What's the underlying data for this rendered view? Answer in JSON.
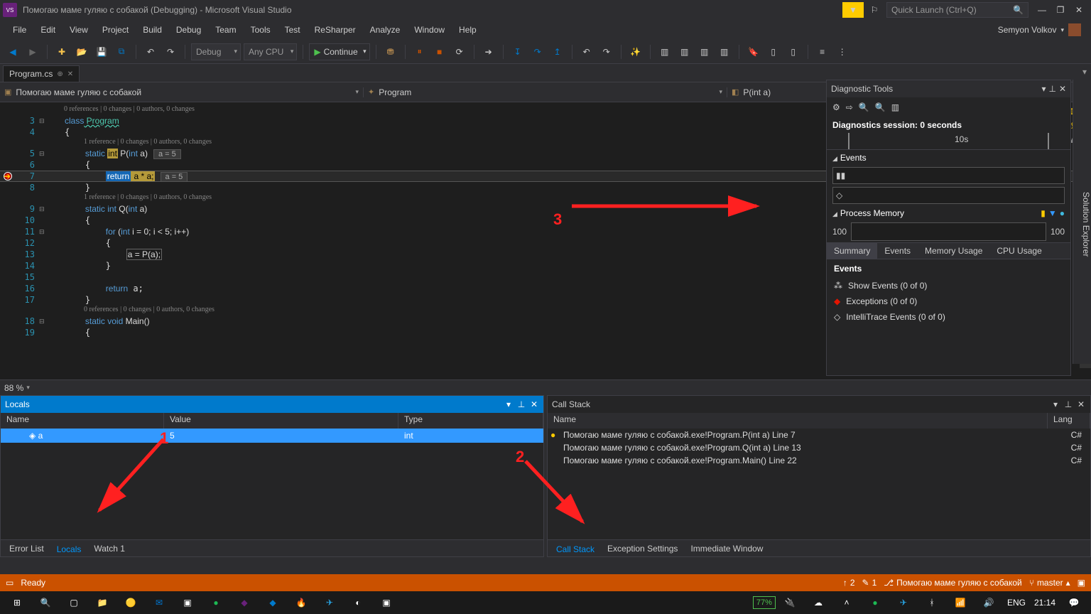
{
  "title": "Помогаю маме гуляю с собакой (Debugging) - Microsoft Visual Studio",
  "search_placeholder": "Quick Launch (Ctrl+Q)",
  "user": "Semyon Volkov",
  "menu": [
    "File",
    "Edit",
    "View",
    "Project",
    "Build",
    "Debug",
    "Team",
    "Tools",
    "Test",
    "ReSharper",
    "Analyze",
    "Window",
    "Help"
  ],
  "toolbar": {
    "config": "Debug",
    "platform": "Any CPU",
    "continue": "Continue"
  },
  "tab": "Program.cs",
  "nav": {
    "scope": "Помогаю маме гуляю с собакой",
    "class": "Program",
    "member": "P(int a)"
  },
  "codelens": {
    "top": "0 references | 0 changes | 0 authors, 0 changes",
    "p": "1 reference | 0 changes | 0 authors, 0 changes",
    "q": "1 reference | 0 changes | 0 authors, 0 changes",
    "main": "0 references | 0 changes | 0 authors, 0 changes"
  },
  "hints": {
    "p_a": "a = 5",
    "ret_a": "a = 5"
  },
  "lines": {
    "l3a": "class",
    "l3b": " Program",
    "l5a": "static ",
    "l5b": "int",
    "l5c": " P(",
    "l5d": "int",
    "l5e": " a)",
    "l7a": "return",
    "l7b": " a * a;",
    "l9a": "static ",
    "l9b": "int",
    "l9c": " Q(",
    "l9d": "int",
    "l9e": " a)",
    "l11a": "for ",
    "l11b": "(",
    "l11c": "int",
    "l11d": " i = 0; i < 5; i++)",
    "l13": "a = P(a);",
    "l16": "return a;",
    "l18a": "static ",
    "l18b": "void",
    "l18c": " Main()"
  },
  "linenums": {
    "n3": "3",
    "n4": "4",
    "n5": "5",
    "n6": "6",
    "n7": "7",
    "n8": "8",
    "n9": "9",
    "n10": "10",
    "n11": "11",
    "n12": "12",
    "n13": "13",
    "n14": "14",
    "n15": "15",
    "n16": "16",
    "n17": "17",
    "n18": "18",
    "n19": "19"
  },
  "zoom": "88 %",
  "locals": {
    "title": "Locals",
    "cols": {
      "name": "Name",
      "value": "Value",
      "type": "Type"
    },
    "row": {
      "name": "a",
      "value": "5",
      "type": "int"
    }
  },
  "callstack": {
    "title": "Call Stack",
    "cols": {
      "name": "Name",
      "lang": "Lang"
    },
    "rows": [
      {
        "name": "Помогаю маме гуляю с собакой.exe!Program.P(int a) Line 7",
        "lang": "C#"
      },
      {
        "name": "Помогаю маме гуляю с собакой.exe!Program.Q(int a) Line 13",
        "lang": "C#"
      },
      {
        "name": "Помогаю маме гуляю с собакой.exe!Program.Main() Line 22",
        "lang": "C#"
      }
    ]
  },
  "bottom_tabs_left": [
    "Error List",
    "Locals",
    "Watch 1"
  ],
  "bottom_tabs_right": [
    "Call Stack",
    "Exception Settings",
    "Immediate Window"
  ],
  "diag": {
    "title": "Diagnostic Tools",
    "session": "Diagnostics session: 0 seconds",
    "timeline_tick": "10s",
    "events": "Events",
    "procmem": "Process Memory",
    "mem_lo": "100",
    "mem_hi": "100",
    "tabs": [
      "Summary",
      "Events",
      "Memory Usage",
      "CPU Usage"
    ],
    "ev_head": "Events",
    "ev1": "Show Events (0 of 0)",
    "ev2": "Exceptions (0 of 0)",
    "ev3": "IntelliTrace Events (0 of 0)"
  },
  "solution_explorer": "Solution Explorer",
  "status": {
    "ready": "Ready",
    "up": "2",
    "pen": "1",
    "proj": "Помогаю маме гуляю с собакой",
    "branch": "master"
  },
  "taskbar": {
    "batt": "77%",
    "lang": "ENG",
    "time": "21:14"
  },
  "annotations": {
    "a1": "1",
    "a2": "2",
    "a3": "3"
  }
}
